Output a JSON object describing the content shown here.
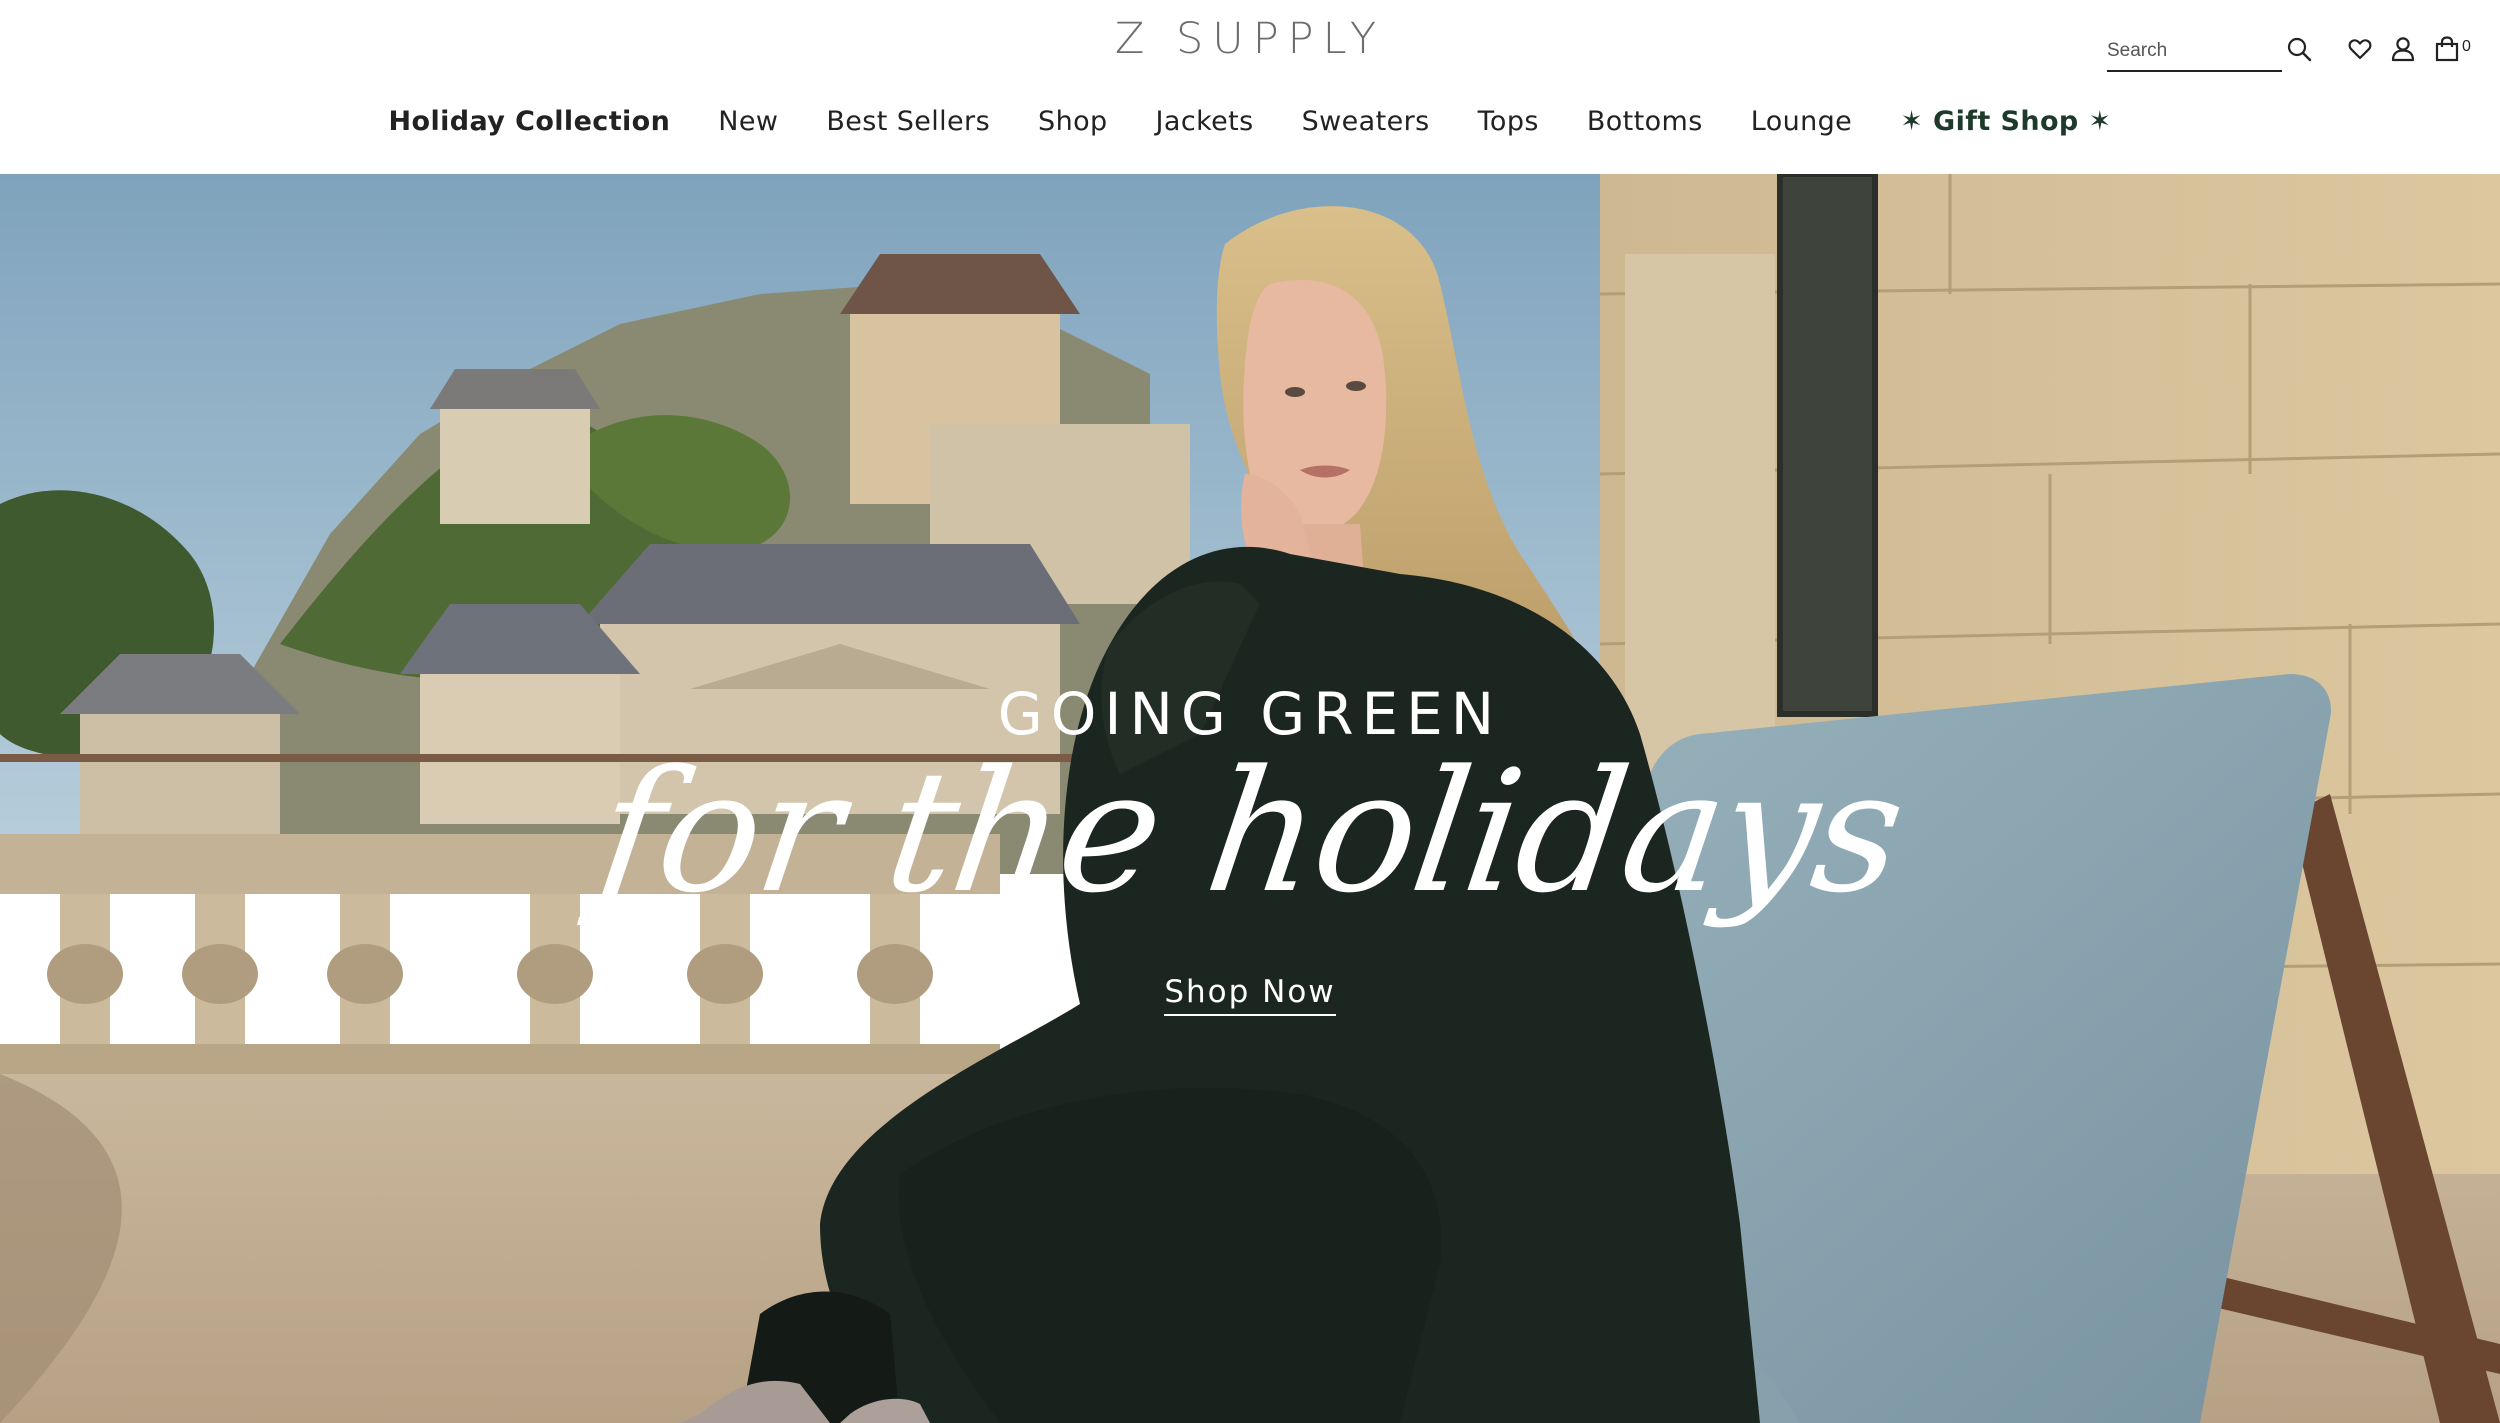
{
  "brand": {
    "logo": "Z SUPPLY"
  },
  "search": {
    "placeholder": "Search",
    "value": ""
  },
  "header_icons": [
    "search-icon",
    "heart-icon",
    "account-icon",
    "bag-icon"
  ],
  "cart": {
    "count": "0"
  },
  "nav": {
    "items": [
      {
        "label": "Holiday Collection"
      },
      {
        "label": "New"
      },
      {
        "label": "Best Sellers"
      },
      {
        "label": "Shop"
      },
      {
        "label": "Jackets"
      },
      {
        "label": "Sweaters"
      },
      {
        "label": "Tops"
      },
      {
        "label": "Bottoms"
      },
      {
        "label": "Lounge"
      },
      {
        "label": "✶ Gift Shop ✶"
      }
    ]
  },
  "hero": {
    "headline": "GOING GREEN",
    "script": "for the holidays",
    "cta": "Shop Now"
  },
  "colors": {
    "text": "#1f1f1f",
    "gift_accent": "#1e3a2a",
    "hero_text": "#ffffff",
    "sweater_green": "#1c2620",
    "chair_blue": "#8fa8b2",
    "sky": "#8fb1c9"
  }
}
